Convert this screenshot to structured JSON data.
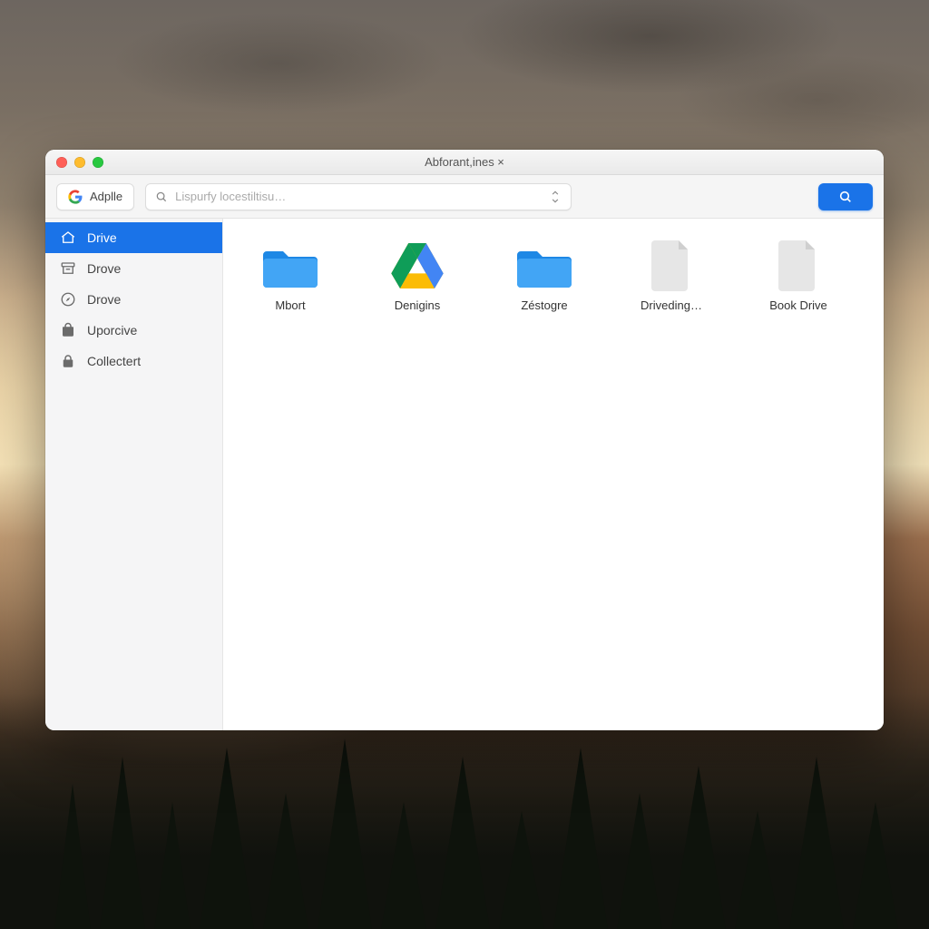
{
  "window": {
    "title": "Abforant,ines ×"
  },
  "toolbar": {
    "account_label": "Adplle",
    "search_placeholder": "Lispurfy locestiltisu…"
  },
  "sidebar": {
    "items": [
      {
        "label": "Drive",
        "icon": "home",
        "active": true
      },
      {
        "label": "Drove",
        "icon": "archive",
        "active": false
      },
      {
        "label": "Drove",
        "icon": "compass",
        "active": false
      },
      {
        "label": "Uporcive",
        "icon": "bag",
        "active": false
      },
      {
        "label": "Collectert",
        "icon": "lock",
        "active": false
      }
    ]
  },
  "content": {
    "items": [
      {
        "label": "Mbort",
        "kind": "folder"
      },
      {
        "label": "Denigins",
        "kind": "drive"
      },
      {
        "label": "Zéstogre",
        "kind": "folder"
      },
      {
        "label": "Driveding…",
        "kind": "document"
      },
      {
        "label": "Book Drive",
        "kind": "document"
      }
    ]
  },
  "colors": {
    "accent": "#1a73e8",
    "folder": "#2196f3"
  }
}
